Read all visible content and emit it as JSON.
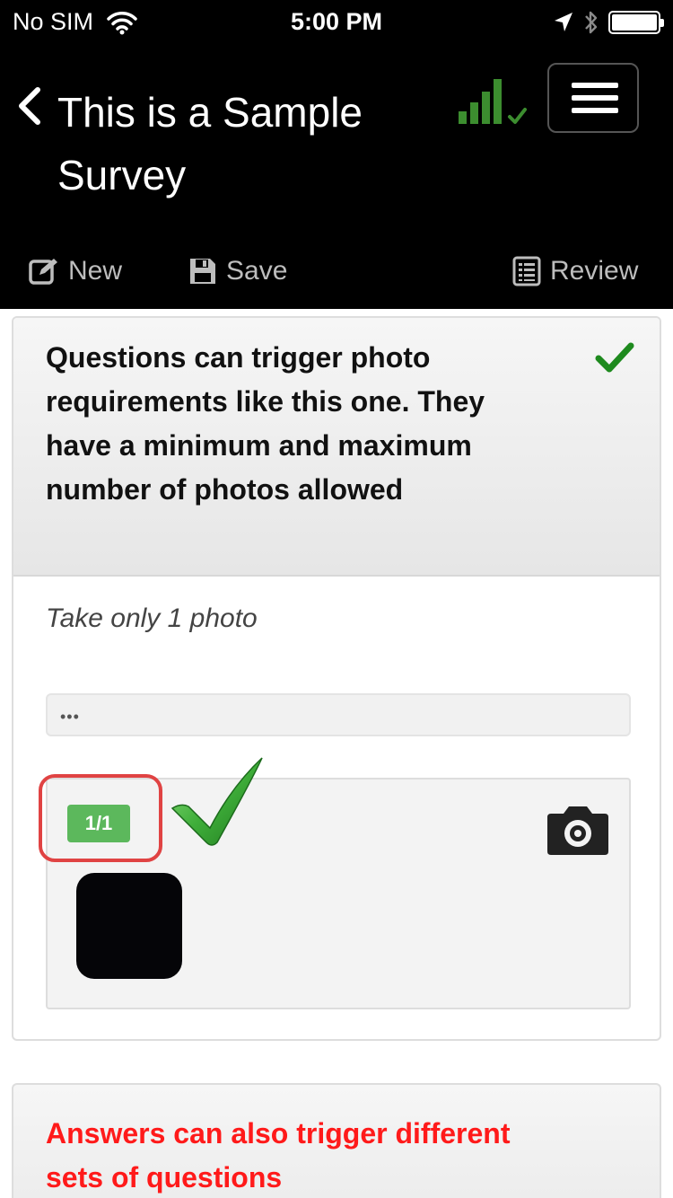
{
  "status_bar": {
    "carrier": "No SIM",
    "time": "5:00 PM"
  },
  "header": {
    "title": "This is a Sample Survey",
    "toolbar": {
      "new_label": "New",
      "save_label": "Save",
      "review_label": "Review"
    }
  },
  "question": {
    "text": "Questions can trigger photo requirements like this one. They have a minimum and maximum number of photos allowed",
    "instruction": "Take only 1 photo",
    "answer_placeholder": "•••",
    "photo_count": "1/1"
  },
  "next_question": {
    "text": "Answers can also trigger different sets of questions"
  },
  "colors": {
    "header_bg": "#000000",
    "signal_green": "#3c8d2f",
    "badge_green": "#5cb85c",
    "highlight_red": "#e04343",
    "answer_red": "#ff1a1a"
  }
}
